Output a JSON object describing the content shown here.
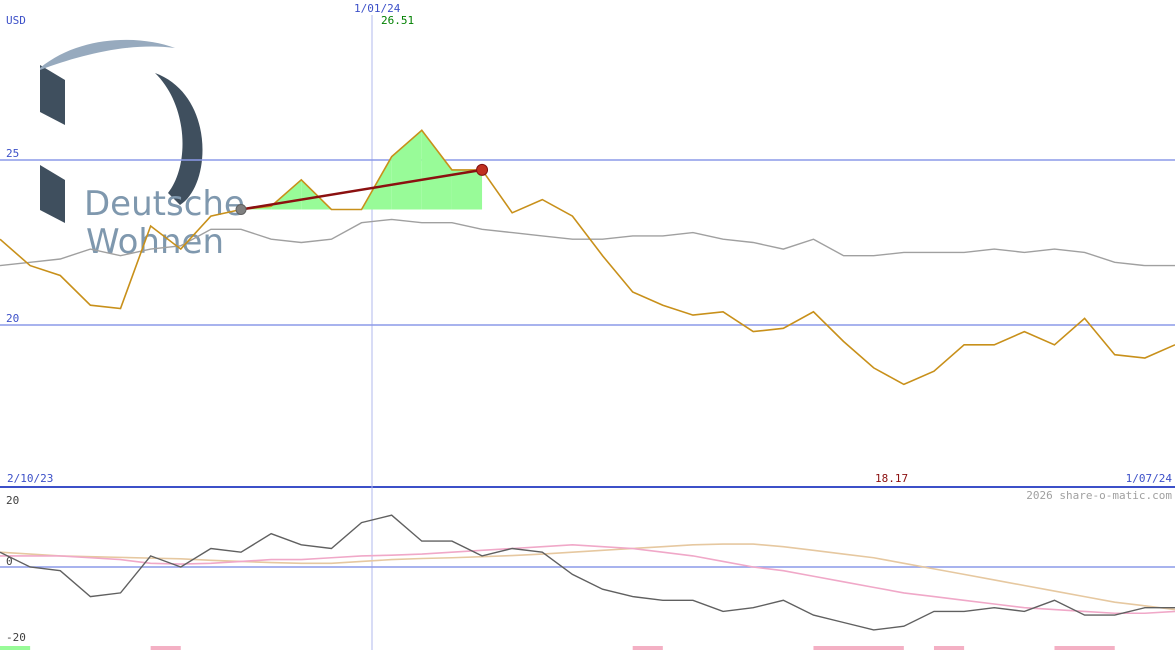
{
  "header": {
    "currency": "USD",
    "marker_date": "1/01/24",
    "marker_value": "26.51",
    "start_date": "2/10/23",
    "end_date": "1/07/24",
    "last_value": "18.17",
    "copyright": "2026 share-o-matic.com"
  },
  "logo": {
    "line1": "Deutsche",
    "line2": "Wohnen"
  },
  "colors": {
    "price": "#c8901a",
    "index": "#a0a0a0",
    "gain_fill": "#98fb98",
    "loss_fill": "#f4b0c4",
    "grid": "#8c9ae8",
    "marker": "#b2b8ee",
    "osc_main": "#606060",
    "osc_pink": "#f0a8c8",
    "osc_tan": "#e6c8a0",
    "trade_line": "#8b1010",
    "label_blue": "#3c50c8",
    "label_green": "#008000",
    "label_red": "#8b1010",
    "logo_dark": "#3f4f5e",
    "logo_light": "#97aabe"
  },
  "chart_data": [
    {
      "type": "line",
      "ylabel": "USD",
      "ylim": [
        15,
        28
      ],
      "yticks": [
        {
          "value": 25,
          "label": "25"
        },
        {
          "value": 20,
          "label": "20"
        }
      ],
      "grid": true,
      "series": [
        {
          "values": [
            22.6,
            21.8,
            21.5,
            20.6,
            20.5,
            23.0,
            22.3,
            23.3,
            23.5,
            23.6,
            24.4,
            23.5,
            23.5,
            25.1,
            25.9,
            24.7,
            24.7,
            23.4,
            23.8,
            23.3,
            22.1,
            21.0,
            20.6,
            20.3,
            20.4,
            19.8,
            19.9,
            20.4,
            19.5,
            18.7,
            18.2,
            18.6,
            19.4,
            19.4,
            19.8,
            19.4,
            20.2,
            19.1,
            19.0,
            19.4
          ]
        },
        {
          "values": [
            21.8,
            21.9,
            22.0,
            22.3,
            22.1,
            22.3,
            22.4,
            22.9,
            22.9,
            22.6,
            22.5,
            22.6,
            23.1,
            23.2,
            23.1,
            23.1,
            22.9,
            22.8,
            22.7,
            22.6,
            22.6,
            22.7,
            22.7,
            22.8,
            22.6,
            22.5,
            22.3,
            22.6,
            22.1,
            22.1,
            22.2,
            22.2,
            22.2,
            22.3,
            22.2,
            22.3,
            22.2,
            21.9,
            21.8,
            21.8
          ]
        }
      ],
      "trades": [
        {
          "start": 8,
          "end": 16
        }
      ]
    },
    {
      "type": "line",
      "ylim": [
        -20,
        20
      ],
      "yticks": [
        {
          "value": 20,
          "label": "20"
        },
        {
          "value": 0,
          "label": "0"
        },
        {
          "value": -20,
          "label": "-20"
        }
      ],
      "grid": true,
      "series": [
        {
          "values": [
            4,
            0,
            -1,
            -8,
            -7,
            3,
            0,
            5,
            4,
            9,
            6,
            5,
            12,
            14,
            7,
            7,
            3,
            5,
            4,
            -2,
            -6,
            -8,
            -9,
            -9,
            -12,
            -11,
            -9,
            -13,
            -15,
            -17,
            -16,
            -12,
            -12,
            -11,
            -12,
            -9,
            -13,
            -13,
            -11,
            -11
          ]
        },
        {
          "values": [
            3,
            3,
            3,
            2.5,
            2,
            1,
            0.8,
            1,
            1.5,
            2,
            2,
            2.5,
            3,
            3.2,
            3.5,
            4,
            4.5,
            5,
            5.5,
            6,
            5.5,
            5,
            4,
            3,
            1.5,
            0,
            -1,
            -2.5,
            -4,
            -5.5,
            -7,
            -8,
            -9,
            -10,
            -11,
            -11.5,
            -12,
            -12.5,
            -12.5,
            -12
          ]
        },
        {
          "values": [
            4,
            3.5,
            3,
            2.8,
            2.6,
            2.4,
            2.2,
            1.8,
            1.5,
            1.2,
            1,
            1,
            1.5,
            2,
            2.3,
            2.5,
            2.8,
            3.1,
            3.5,
            4,
            4.5,
            5,
            5.5,
            6,
            6.2,
            6.2,
            5.5,
            4.5,
            3.5,
            2.5,
            1,
            -0.5,
            -2,
            -3.5,
            -5,
            -6.5,
            -8,
            -9.5,
            -10.5,
            -11.5
          ]
        }
      ]
    }
  ],
  "signal_bars": [
    {
      "start": 0,
      "end": 1,
      "kind": "gain"
    },
    {
      "start": 5,
      "end": 6,
      "kind": "loss"
    },
    {
      "start": 21,
      "end": 22,
      "kind": "loss"
    },
    {
      "start": 27,
      "end": 30,
      "kind": "loss"
    },
    {
      "start": 31,
      "end": 32,
      "kind": "loss"
    },
    {
      "start": 35,
      "end": 37,
      "kind": "loss"
    }
  ]
}
